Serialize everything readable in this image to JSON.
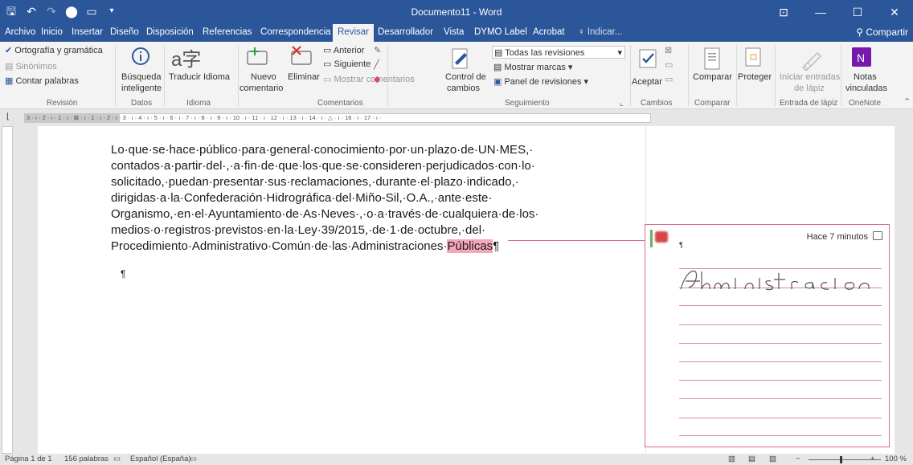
{
  "window": {
    "title": "Documento11 - Word",
    "buttons": {
      "restore": "⊡",
      "minimize": "—",
      "maximize": "☐",
      "close": "✕"
    }
  },
  "qat": {
    "save": "🖫",
    "undo": "↶",
    "redo": "↷",
    "circle": "⬤",
    "present": "▭",
    "more": "▾"
  },
  "tabs": [
    "Archivo",
    "Inicio",
    "Insertar",
    "Diseño",
    "Disposición",
    "Referencias",
    "Correspondencia",
    "Revisar",
    "Desarrollador",
    "Vista",
    "DYMO Label",
    "Acrobat"
  ],
  "tell_me": "Indicar...",
  "share": "Compartir",
  "ribbon": {
    "revision": {
      "spelling": "Ortografía y gramática",
      "synonyms": "Sinónimos",
      "wordcount": "Contar palabras",
      "group": "Revisión"
    },
    "datos": {
      "smart1": "Búsqueda",
      "smart2": "inteligente",
      "group": "Datos"
    },
    "idioma": {
      "translate": "Traducir",
      "language": "Idioma",
      "group": "Idioma"
    },
    "comentarios": {
      "new1": "Nuevo",
      "new2": "comentario",
      "delete": "Eliminar",
      "previous": "Anterior",
      "next": "Siguiente",
      "show": "Mostrar comentarios",
      "group": "Comentarios"
    },
    "seguimiento": {
      "control1": "Control de",
      "control2": "cambios",
      "all": "Todas las revisiones",
      "marks": "Mostrar marcas",
      "panel": "Panel de revisiones",
      "group": "Seguimiento"
    },
    "cambios": {
      "accept": "Aceptar",
      "group": "Cambios"
    },
    "comparar": {
      "compare": "Comparar",
      "group": "Comparar"
    },
    "proteger": {
      "protect": "Proteger"
    },
    "ink": {
      "start1": "Iniciar entradas",
      "start2": "de lápiz",
      "group": "Entrada de lápiz"
    },
    "onenote": {
      "notes1": "Notas",
      "notes2": "vinculadas",
      "group": "OneNote"
    }
  },
  "ruler": "3 · ı · 2 · ı · 1 · ı · ⊠ · ı · 1 · ı · 2 · ı · 3 · ı · 4 · ı · 5 · ı · 6 · ı · 7 · ı · 8 · ı · 9 · ı · 10 · ı · 11 · ı · 12 · ı · 13 · ı · 14 · ı · △ · ı · 16 · ı · 17 · ı ·",
  "document": {
    "lines": [
      "Lo·que·se·hace·público·para·general·conocimiento·por·un·plazo·de·UN·MES,·",
      "contados·a·partir·del·,·a·fin·de·que·los·que·se·consideren·perjudicados·con·lo·",
      "solicitado,·puedan·presentar·sus·reclamaciones,·durante·el·plazo·indicado,·",
      "dirigidas·a·la·Confederación·Hidrográfica·del·Miño-Sil,·O.A.,·ante·este·",
      "Organismo,·en·el·Ayuntamiento·de·As·Neves·,·o·a·través·de·cualquiera·de·los·",
      "medios·o·registros·previstos·en·la·Ley·39/2015,·de·1·de·octubre,·del·"
    ],
    "last_line_pre": "Procedimiento·Administrativo·Común·de·las·Administraciones·",
    "last_line_highlight": "Públicas",
    "last_line_post": "¶",
    "empty_paragraph": "¶"
  },
  "comment": {
    "time": "Hace 7 minutos",
    "pilcrow": "¶",
    "ink_text": "Administración"
  },
  "status": {
    "page": "Página 1 de 1",
    "words": "156 palabras",
    "language": "Español (España)",
    "zoom": "100 %"
  },
  "colors": {
    "accent": "#2b579a",
    "highlight": "#f4a7b9",
    "comment_border": "#d66b86"
  }
}
